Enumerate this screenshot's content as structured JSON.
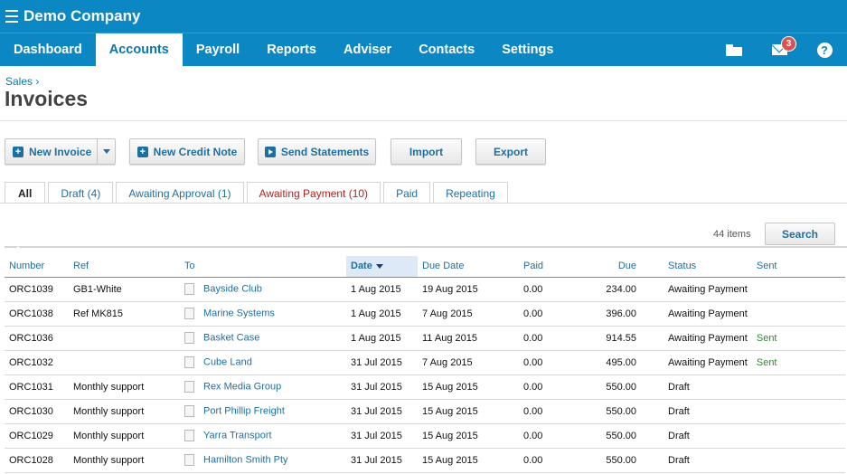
{
  "app": {
    "company": "Demo Company"
  },
  "nav": {
    "tabs": [
      {
        "label": "Dashboard"
      },
      {
        "label": "Accounts",
        "active": true
      },
      {
        "label": "Payroll"
      },
      {
        "label": "Reports"
      },
      {
        "label": "Adviser"
      },
      {
        "label": "Contacts"
      },
      {
        "label": "Settings"
      }
    ],
    "mail_count": "3",
    "help_label": "?"
  },
  "breadcrumb": "Sales ›",
  "page_title": "Invoices",
  "toolbar": {
    "new_invoice": "New Invoice",
    "new_credit_note": "New Credit Note",
    "send_statements": "Send Statements",
    "import": "Import",
    "export": "Export"
  },
  "filter_tabs": [
    {
      "label": "All"
    },
    {
      "label": "Draft (4)"
    },
    {
      "label": "Awaiting Approval (1)"
    },
    {
      "label": "Awaiting Payment (10)"
    },
    {
      "label": "Paid"
    },
    {
      "label": "Repeating"
    }
  ],
  "items_count": "44 items",
  "search_label": "Search",
  "table": {
    "headers": {
      "number": "Number",
      "ref": "Ref",
      "to": "To",
      "date": "Date",
      "due_date": "Due Date",
      "paid": "Paid",
      "due": "Due",
      "status": "Status",
      "sent": "Sent"
    },
    "rows": [
      {
        "number": "ORC1039",
        "ref": "GB1-White",
        "to": "Bayside Club",
        "date": "1 Aug 2015",
        "due_date": "19 Aug 2015",
        "paid": "0.00",
        "due": "234.00",
        "status": "Awaiting Payment",
        "sent": ""
      },
      {
        "number": "ORC1038",
        "ref": "Ref MK815",
        "to": "Marine Systems",
        "date": "1 Aug 2015",
        "due_date": "7 Aug 2015",
        "paid": "0.00",
        "due": "396.00",
        "status": "Awaiting Payment",
        "sent": ""
      },
      {
        "number": "ORC1036",
        "ref": "",
        "to": "Basket Case",
        "date": "1 Aug 2015",
        "due_date": "11 Aug 2015",
        "paid": "0.00",
        "due": "914.55",
        "status": "Awaiting Payment",
        "sent": "Sent"
      },
      {
        "number": "ORC1032",
        "ref": "",
        "to": "Cube Land",
        "date": "31 Jul 2015",
        "due_date": "7 Aug 2015",
        "paid": "0.00",
        "due": "495.00",
        "status": "Awaiting Payment",
        "sent": "Sent"
      },
      {
        "number": "ORC1031",
        "ref": "Monthly support",
        "to": "Rex Media Group",
        "date": "31 Jul 2015",
        "due_date": "15 Aug 2015",
        "paid": "0.00",
        "due": "550.00",
        "status": "Draft",
        "sent": ""
      },
      {
        "number": "ORC1030",
        "ref": "Monthly support",
        "to": "Port Phillip Freight",
        "date": "31 Jul 2015",
        "due_date": "15 Aug 2015",
        "paid": "0.00",
        "due": "550.00",
        "status": "Draft",
        "sent": ""
      },
      {
        "number": "ORC1029",
        "ref": "Monthly support",
        "to": "Yarra Transport",
        "date": "31 Jul 2015",
        "due_date": "15 Aug 2015",
        "paid": "0.00",
        "due": "550.00",
        "status": "Draft",
        "sent": ""
      },
      {
        "number": "ORC1028",
        "ref": "Monthly support",
        "to": "Hamilton Smith Pty",
        "date": "31 Jul 2015",
        "due_date": "15 Aug 2015",
        "paid": "0.00",
        "due": "550.00",
        "status": "Draft",
        "sent": ""
      }
    ]
  }
}
